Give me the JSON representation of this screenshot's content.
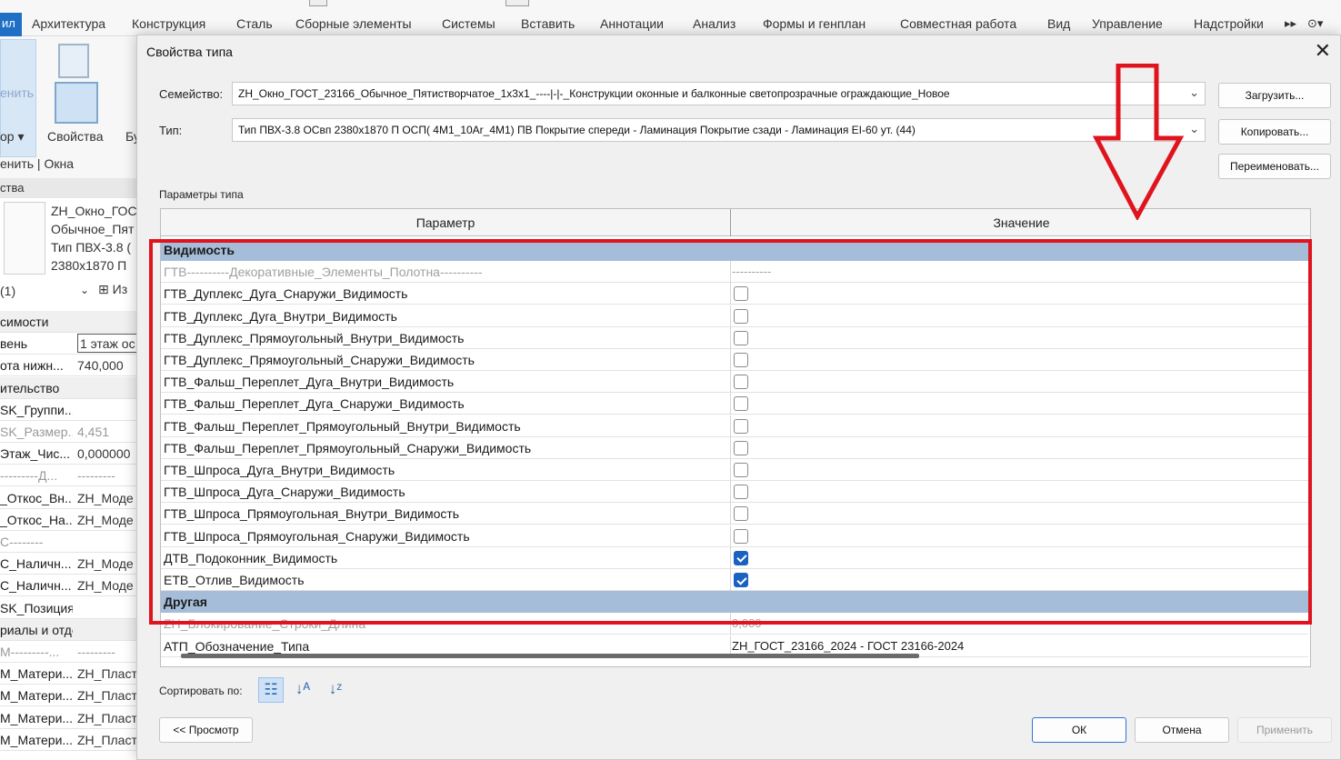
{
  "ribbon": {
    "tabs": [
      "Архитектура",
      "Конструкция",
      "Сталь",
      "Сборные элементы",
      "Системы",
      "Вставить",
      "Аннотации",
      "Анализ",
      "Формы и генплан",
      "Совместная работа",
      "Вид",
      "Управление",
      "Надстройки"
    ],
    "file_tab": "ил",
    "more": "▸▸",
    "extra_icon": "⊙▾",
    "bg_labels": {
      "select": "енить",
      "select_dd": "ор ▾",
      "properties": "Свойства",
      "cut": "Бу",
      "context": "енить | Окна"
    }
  },
  "bg_props": {
    "header": "ства",
    "preview_lines": [
      "ZH_Окно_ГОС",
      "Обычное_Пят",
      "Тип ПВХ-3.8 (",
      "2380x1870 П"
    ],
    "instance_selector": {
      "count": "(1)",
      "edit": "Из"
    },
    "rows": [
      {
        "name": "симости",
        "value": "",
        "kind": "group"
      },
      {
        "name": "вень",
        "value": "1 этаж ос",
        "kind": "normal"
      },
      {
        "name": "ота нижн...",
        "value": "740,000",
        "kind": "normal"
      },
      {
        "name": "ительство",
        "value": "",
        "kind": "group"
      },
      {
        "name": "SK_Группи...",
        "value": "",
        "kind": "normal"
      },
      {
        "name": "SK_Размер...",
        "value": "4,451",
        "kind": "grey"
      },
      {
        "name": "Этаж_Чис...",
        "value": "0,000000",
        "kind": "normal"
      },
      {
        "name": "---------Д...",
        "value": "---------",
        "kind": "grey"
      },
      {
        "name": "_Откос_Вн...",
        "value": "ZH_Моде",
        "kind": "normal"
      },
      {
        "name": "_Откос_На...",
        "value": "ZH_Моде",
        "kind": "normal"
      },
      {
        "name": "С--------",
        "value": "",
        "kind": "grey"
      },
      {
        "name": "С_Наличн...",
        "value": "ZH_Моде",
        "kind": "normal"
      },
      {
        "name": "С_Наличн...",
        "value": "ZH_Моде",
        "kind": "normal"
      },
      {
        "name": "SK_Позиция",
        "value": "",
        "kind": "normal"
      },
      {
        "name": "риалы и отделка",
        "value": "",
        "kind": "group"
      },
      {
        "name": "М---------...",
        "value": "---------",
        "kind": "grey"
      },
      {
        "name": "М_Матери...",
        "value": "ZH_Пласт",
        "kind": "normal"
      },
      {
        "name": "М_Матери...",
        "value": "ZH_Пласт",
        "kind": "normal"
      },
      {
        "name": "М_Матери...",
        "value": "ZH_Пласт",
        "kind": "normal"
      },
      {
        "name": "М_Матери...",
        "value": "ZH_Пласт",
        "kind": "normal"
      }
    ]
  },
  "dialog": {
    "title": "Свойства типа",
    "close": "✕",
    "family_label": "Семейство:",
    "family_value": "ZH_Окно_ГОСТ_23166_Обычное_Пятистворчатое_1x3x1_----|-|-_Конструкции оконные и балконные светопрозрачные ограждающие_Новое",
    "type_label": "Тип:",
    "type_value": "Тип ПВХ-3.8 ОСвп 2380x1870 П ОСП( 4М1_10Ar_4М1) ПВ Покрытие спереди - Ламинация Покрытие сзади - Ламинация EI-60 ут. (44)",
    "load_btn": "Загрузить...",
    "copy_btn": "Копировать...",
    "rename_btn": "Переименовать...",
    "type_params_label": "Параметры типа",
    "col_param": "Параметр",
    "col_value": "Значение",
    "sort_label": "Сортировать по:",
    "preview_btn": "<< Просмотр",
    "ok_btn": "ОК",
    "cancel_btn": "Отмена",
    "apply_btn": "Применить"
  },
  "grid_rows": [
    {
      "kind": "section",
      "name": "Видимость"
    },
    {
      "kind": "grey",
      "name": "ГТВ----------Декоративные_Элементы_Полотна----------",
      "value": "----------"
    },
    {
      "kind": "check",
      "name": "ГТВ_Дуплекс_Дуга_Снаружи_Видимость",
      "checked": false
    },
    {
      "kind": "check",
      "name": "ГТВ_Дуплекс_Дуга_Внутри_Видимость",
      "checked": false
    },
    {
      "kind": "check",
      "name": "ГТВ_Дуплекс_Прямоугольный_Внутри_Видимость",
      "checked": false
    },
    {
      "kind": "check",
      "name": "ГТВ_Дуплекс_Прямоугольный_Снаружи_Видимость",
      "checked": false
    },
    {
      "kind": "check",
      "name": "ГТВ_Фальш_Переплет_Дуга_Внутри_Видимость",
      "checked": false
    },
    {
      "kind": "check",
      "name": "ГТВ_Фальш_Переплет_Дуга_Снаружи_Видимость",
      "checked": false
    },
    {
      "kind": "check",
      "name": "ГТВ_Фальш_Переплет_Прямоугольный_Внутри_Видимость",
      "checked": false
    },
    {
      "kind": "check",
      "name": "ГТВ_Фальш_Переплет_Прямоугольный_Снаружи_Видимость",
      "checked": false
    },
    {
      "kind": "check",
      "name": "ГТВ_Шпроса_Дуга_Внутри_Видимость",
      "checked": false
    },
    {
      "kind": "check",
      "name": "ГТВ_Шпроса_Дуга_Снаружи_Видимость",
      "checked": false
    },
    {
      "kind": "check",
      "name": "ГТВ_Шпроса_Прямоугольная_Внутри_Видимость",
      "checked": false
    },
    {
      "kind": "check",
      "name": "ГТВ_Шпроса_Прямоугольная_Снаружи_Видимость",
      "checked": false
    },
    {
      "kind": "check",
      "name": "ДТВ_Подоконник_Видимость",
      "checked": true
    },
    {
      "kind": "check",
      "name": "ЕТВ_Отлив_Видимость",
      "checked": true
    },
    {
      "kind": "section",
      "name": "Другая"
    },
    {
      "kind": "grey",
      "name": "ZH_Блокирование_Строки_Длина",
      "value": "0,000"
    },
    {
      "kind": "text",
      "name": "АТП_Обозначение_Типа",
      "value": "ZH_ГОСТ_23166_2024 - ГОСТ 23166-2024"
    }
  ],
  "sort_icons": [
    "sort-grouped-icon",
    "sort-az-icon",
    "sort-za-icon"
  ],
  "colors": {
    "accent": "#1a62c2",
    "section_bg": "#a6bdd9",
    "annotation_red": "#e0141e"
  }
}
